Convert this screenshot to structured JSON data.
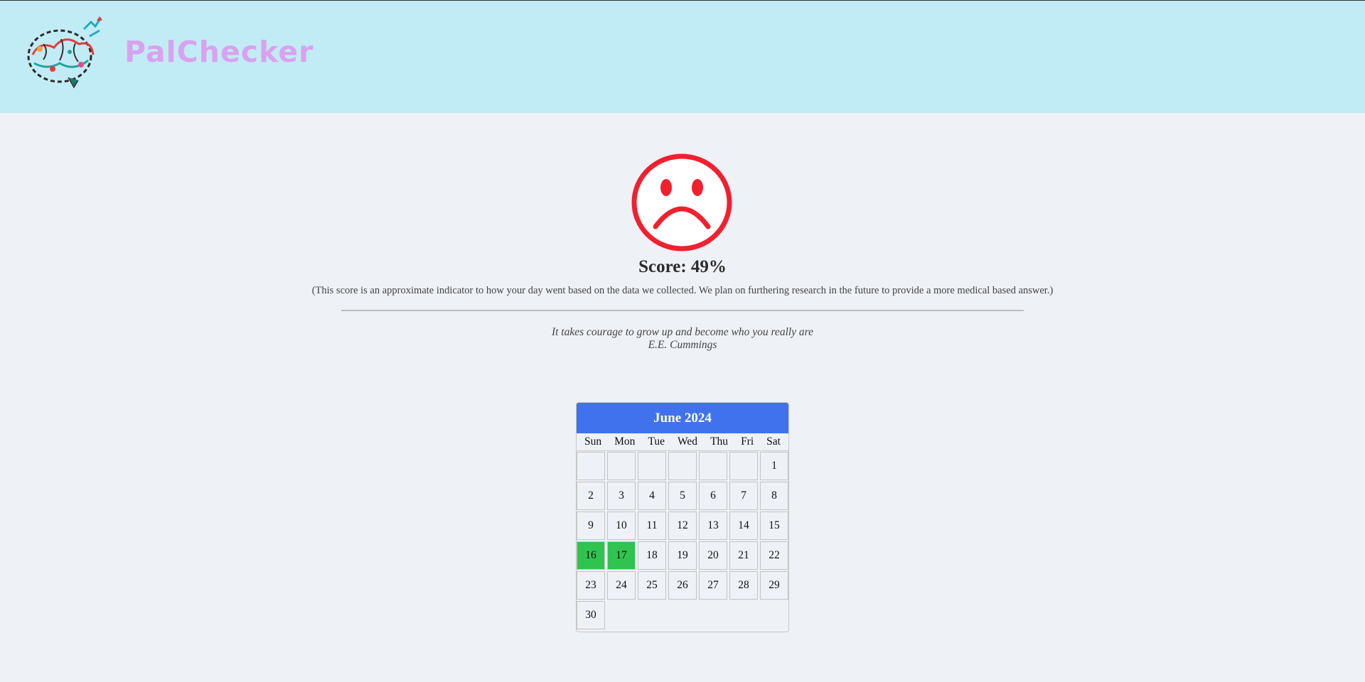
{
  "header": {
    "brand": "PalChecker",
    "logo_icon": "brain-logo-icon",
    "background": "#c1ecf5",
    "brand_color": "#d9a2ee"
  },
  "result": {
    "mood_icon": "sad-face-icon",
    "mood_color": "#f0212f",
    "score_label": "Score: 49%",
    "disclaimer": "(This score is an approximate indicator to how your day went based on the data we collected. We plan on furthering research in the future to provide a more medical based answer.)"
  },
  "quote": {
    "text": "It takes courage to grow up and become who you really are",
    "author": "E.E. Cummings"
  },
  "calendar": {
    "title": "June 2024",
    "header_color": "#4172ee",
    "marked_color": "#2fc44f",
    "weekdays": [
      "Sun",
      "Mon",
      "Tue",
      "Wed",
      "Thu",
      "Fri",
      "Sat"
    ],
    "leading_blank_cells": 6,
    "days": [
      "1",
      "2",
      "3",
      "4",
      "5",
      "6",
      "7",
      "8",
      "9",
      "10",
      "11",
      "12",
      "13",
      "14",
      "15",
      "16",
      "17",
      "18",
      "19",
      "20",
      "21",
      "22",
      "23",
      "24",
      "25",
      "26",
      "27",
      "28",
      "29",
      "30"
    ],
    "marked_days": [
      "16",
      "17"
    ]
  }
}
